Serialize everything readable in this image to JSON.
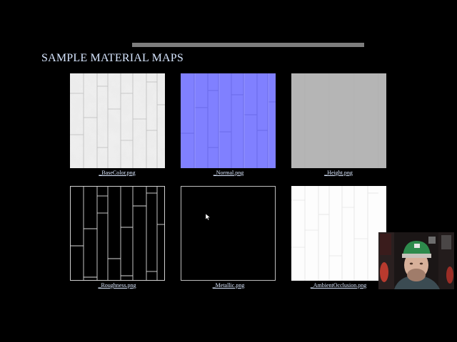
{
  "slide": {
    "title": "SAMPLE MATERIAL MAPS"
  },
  "maps": [
    {
      "caption": "_BaseColor.png",
      "type": "basecolor",
      "color": "#e9e9e9"
    },
    {
      "caption": "_Normal.png",
      "type": "normal",
      "color": "#8080ff"
    },
    {
      "caption": "_Height.png",
      "type": "height",
      "color": "#b5b5b5"
    },
    {
      "caption": "_Roughness.png",
      "type": "roughness",
      "color": "#000000"
    },
    {
      "caption": "_Metallic.png",
      "type": "metallic",
      "color": "#000000"
    },
    {
      "caption": "_AmbientOcclusion.png",
      "type": "ao",
      "color": "#ffffff"
    }
  ],
  "webcam": {
    "icon": "webcam-presenter-feed"
  },
  "colors": {
    "background": "#000000",
    "title": "#d7e6ff",
    "progress_bar": "#7d7d7d"
  }
}
